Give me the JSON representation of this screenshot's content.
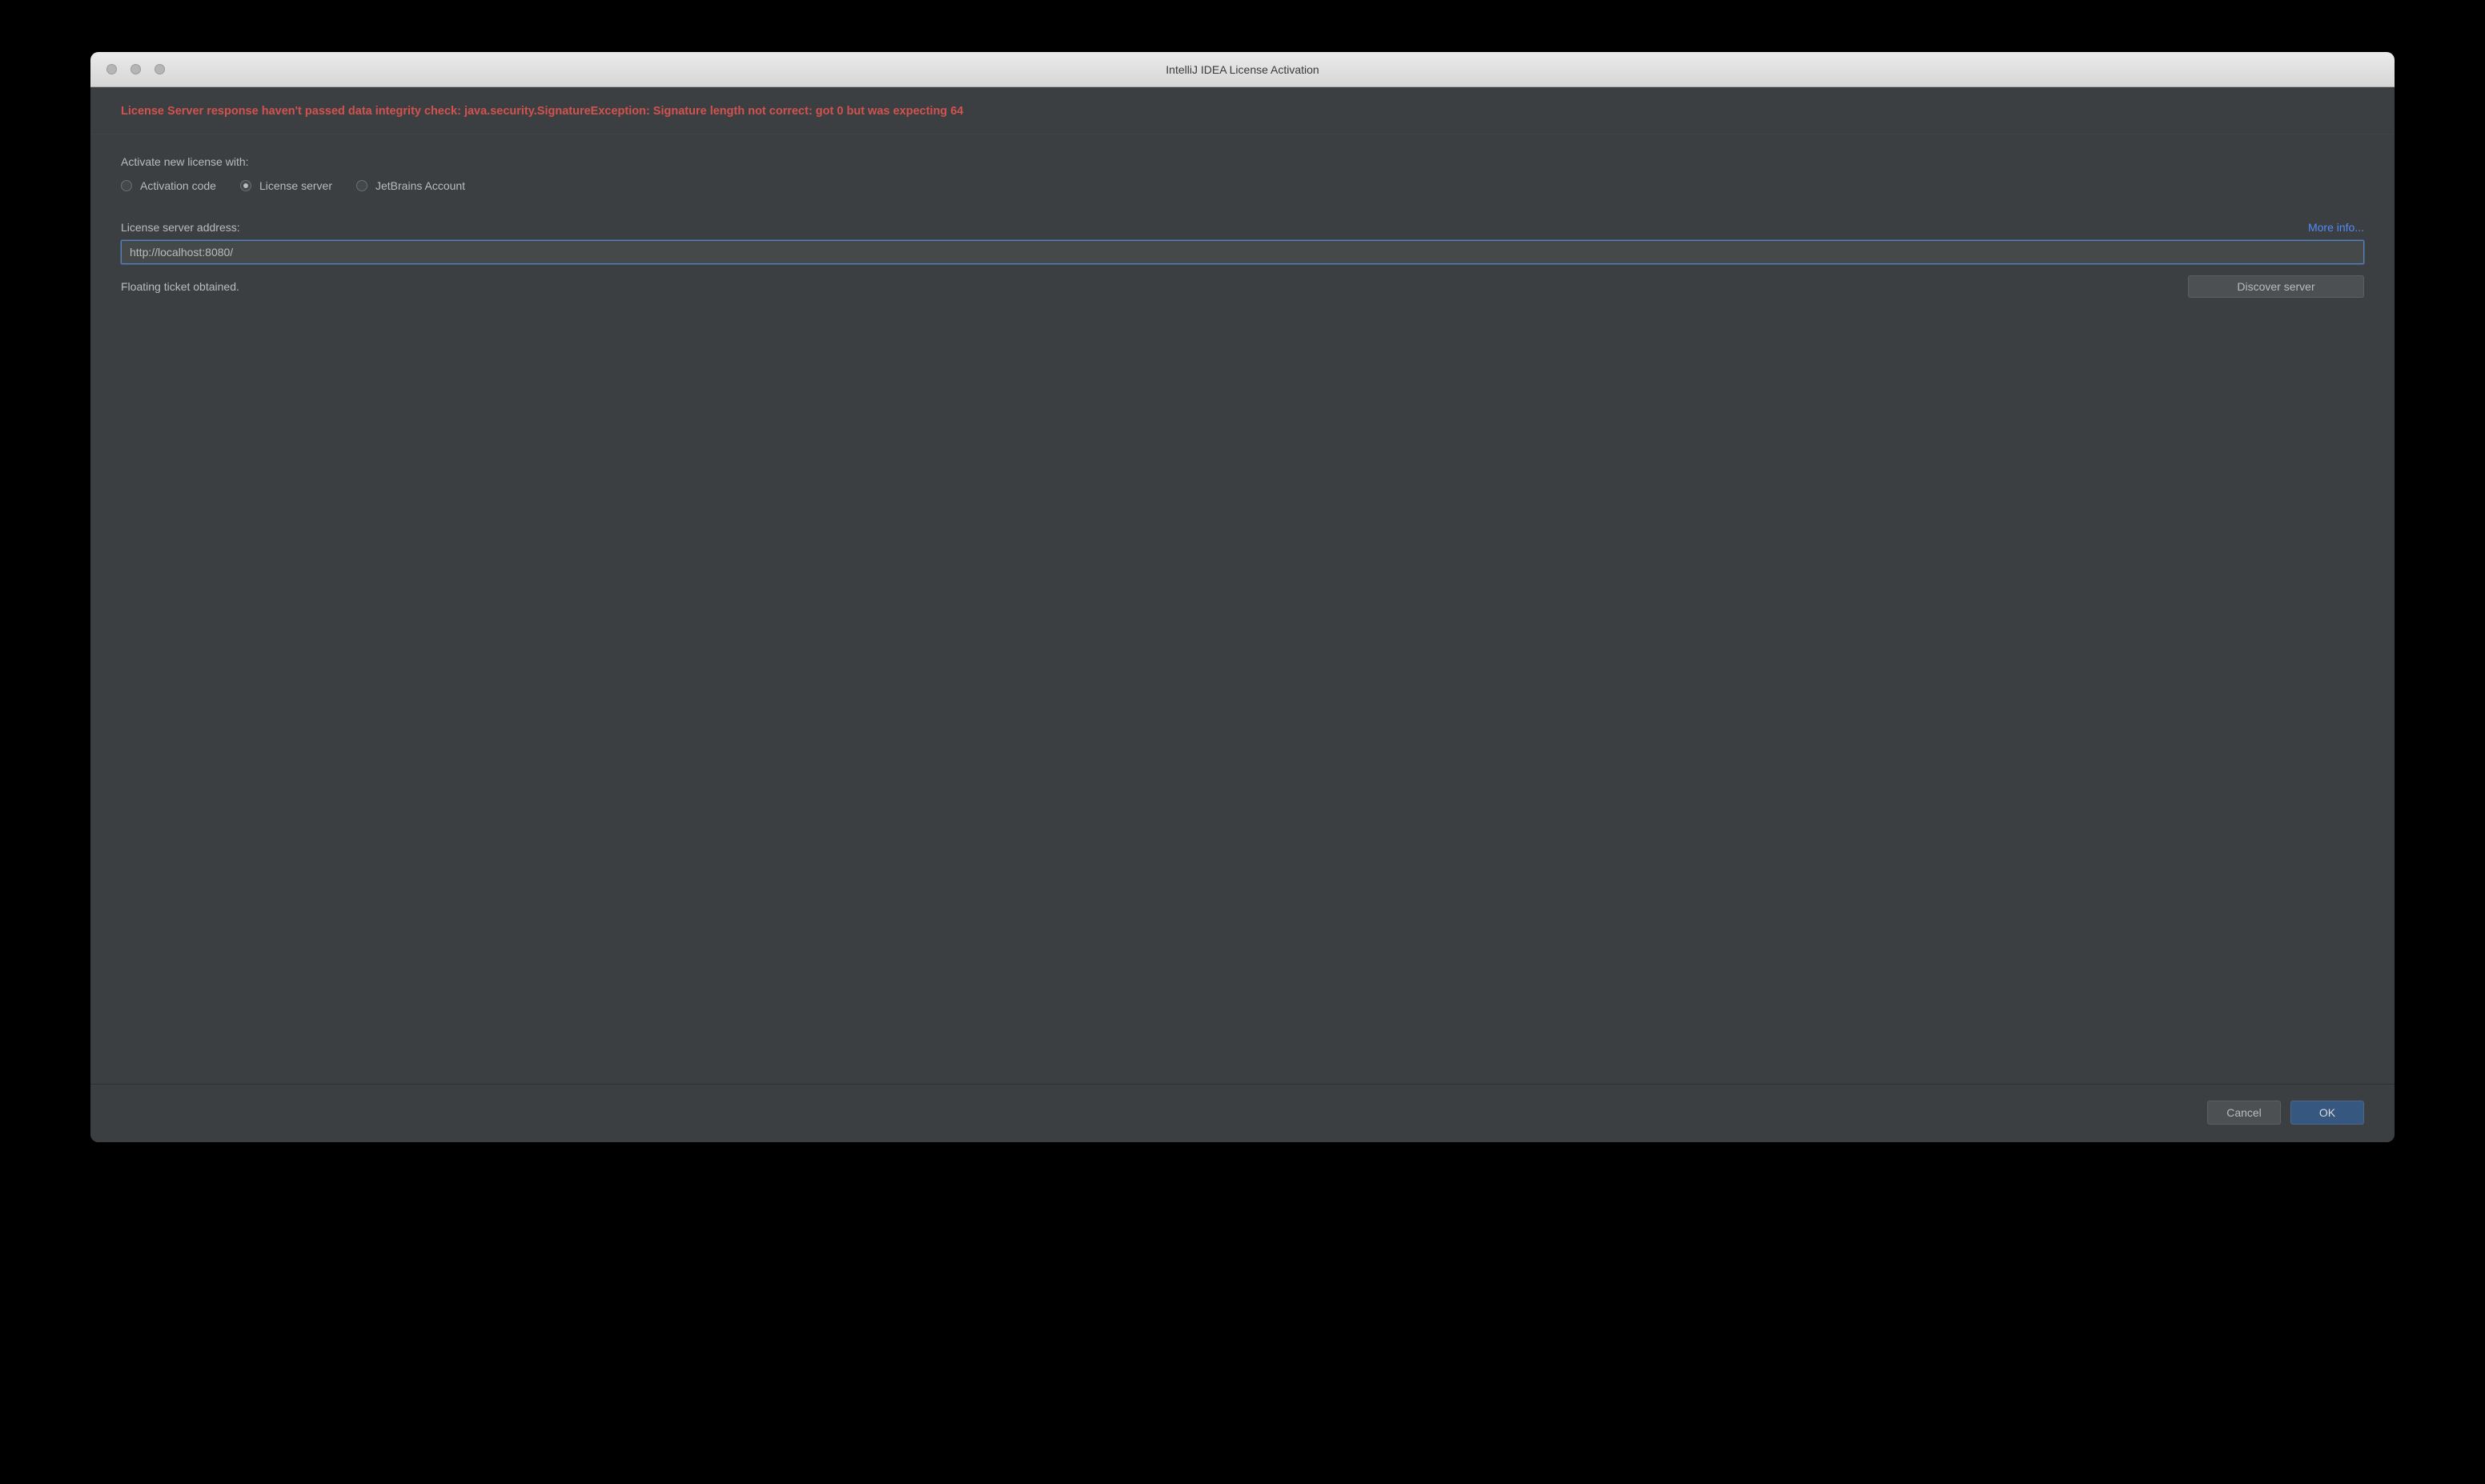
{
  "titlebar": {
    "title": "IntelliJ IDEA License Activation"
  },
  "error": {
    "message": "License Server response haven't passed data integrity check: java.security.SignatureException: Signature length not correct: got 0 but was expecting 64"
  },
  "activate": {
    "label": "Activate new license with:",
    "options": [
      {
        "label": "Activation code",
        "selected": false
      },
      {
        "label": "License server",
        "selected": true
      },
      {
        "label": "JetBrains Account",
        "selected": false
      }
    ]
  },
  "address": {
    "label": "License server address:",
    "more_info": "More info...",
    "value": "http://localhost:8080/"
  },
  "status": {
    "text": "Floating ticket obtained."
  },
  "buttons": {
    "discover": "Discover server",
    "cancel": "Cancel",
    "ok": "OK"
  }
}
